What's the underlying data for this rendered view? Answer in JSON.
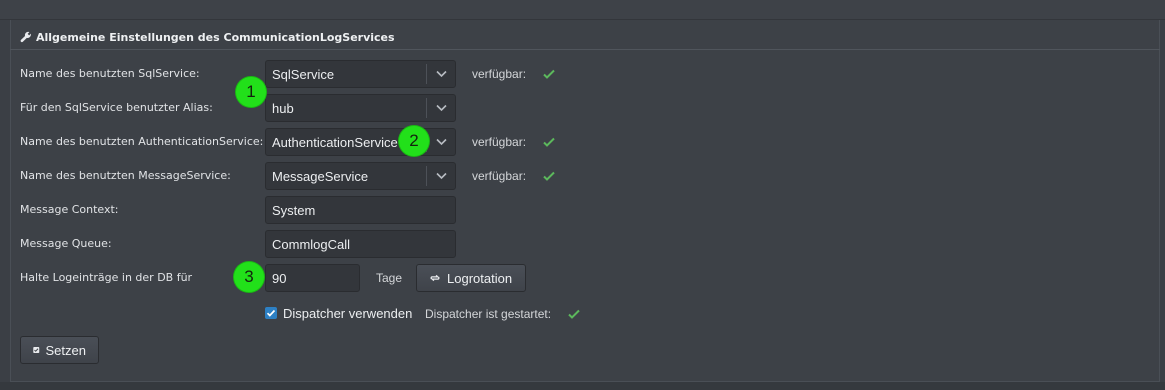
{
  "section": {
    "title": "Allgemeine Einstellungen des CommunicationLogServices",
    "icon": "wrench-icon"
  },
  "rows": {
    "sql_service": {
      "label": "Name des benutzten SqlService:",
      "value": "SqlService",
      "status": "verfügbar:"
    },
    "sql_alias": {
      "label": "Für den SqlService benutzter Alias:",
      "value": "hub"
    },
    "auth_service": {
      "label": "Name des benutzten AuthenticationService:",
      "value": "AuthenticationService",
      "status": "verfügbar:"
    },
    "message_service": {
      "label": "Name des benutzten MessageService:",
      "value": "MessageService",
      "status": "verfügbar:"
    },
    "message_context": {
      "label": "Message Context:",
      "value": "System"
    },
    "message_queue": {
      "label": "Message Queue:",
      "value": "CommlogCall"
    },
    "log_retention": {
      "label": "Halte Logeinträge in der DB für",
      "value": "90",
      "unit": "Tage",
      "button": "Logrotation"
    }
  },
  "dispatcher": {
    "checkbox_label": "Dispatcher verwenden",
    "checked": true,
    "status": "Dispatcher ist gestartet:"
  },
  "set_button": "Setzen",
  "markers": [
    "1",
    "2",
    "3"
  ],
  "colors": {
    "background": "#3b3f45",
    "check_green": "#5cb85c",
    "marker_green": "#22e01a",
    "checkbox_blue": "#2d80c4"
  }
}
